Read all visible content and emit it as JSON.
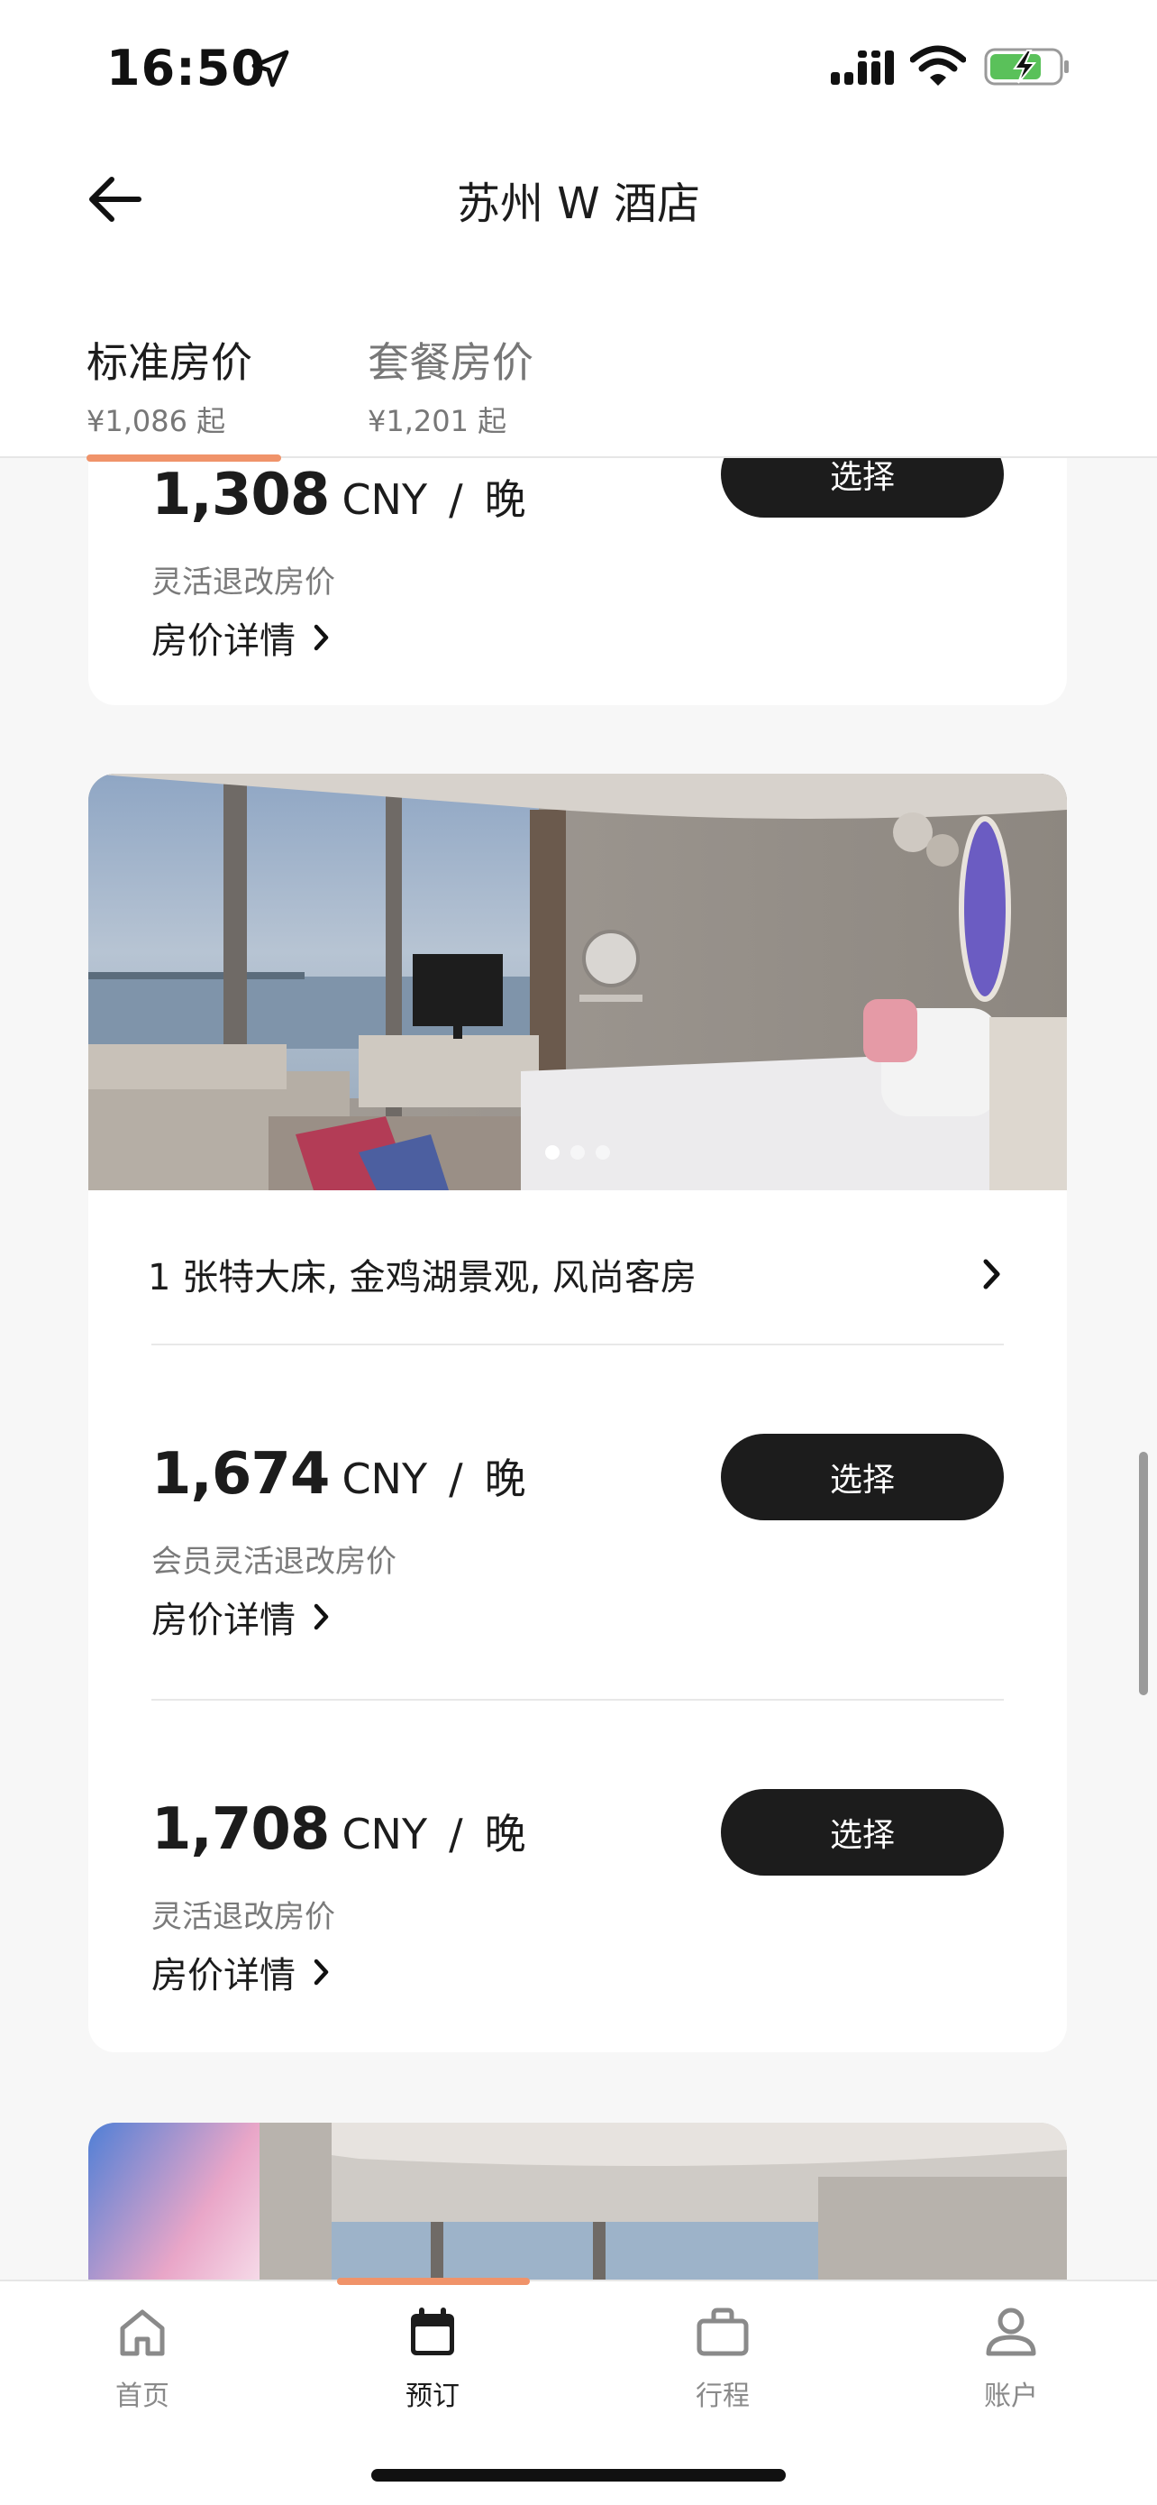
{
  "status_bar": {
    "time": "16:50"
  },
  "header": {
    "title": "苏州 W 酒店"
  },
  "tabs": [
    {
      "label": "标准房价",
      "sub": "¥1,086 起",
      "active": true
    },
    {
      "label": "套餐房价",
      "sub": "¥1,201 起",
      "active": false
    }
  ],
  "rooms": [
    {
      "rates": [
        {
          "price": "1,308",
          "currency": "CNY",
          "slash": "/",
          "unit": "晚",
          "desc": "灵活退改房价",
          "details_label": "房价详情",
          "select_label": "选择"
        }
      ]
    },
    {
      "title": "1 张特大床, 金鸡湖景观, 风尚客房",
      "photo_dots": 3,
      "rates": [
        {
          "price": "1,674",
          "currency": "CNY",
          "slash": "/",
          "unit": "晚",
          "desc": "会员灵活退改房价",
          "details_label": "房价详情",
          "select_label": "选择"
        },
        {
          "price": "1,708",
          "currency": "CNY",
          "slash": "/",
          "unit": "晚",
          "desc": "灵活退改房价",
          "details_label": "房价详情",
          "select_label": "选择"
        }
      ]
    }
  ],
  "bottom_nav": [
    {
      "label": "首页",
      "icon": "home-icon",
      "active": false
    },
    {
      "label": "预订",
      "icon": "calendar-icon",
      "active": true
    },
    {
      "label": "行程",
      "icon": "suitcase-icon",
      "active": false
    },
    {
      "label": "账户",
      "icon": "person-icon",
      "active": false
    }
  ],
  "colors": {
    "accent": "#f0936a",
    "button": "#1c1c1c",
    "background": "#f7f7f7"
  }
}
